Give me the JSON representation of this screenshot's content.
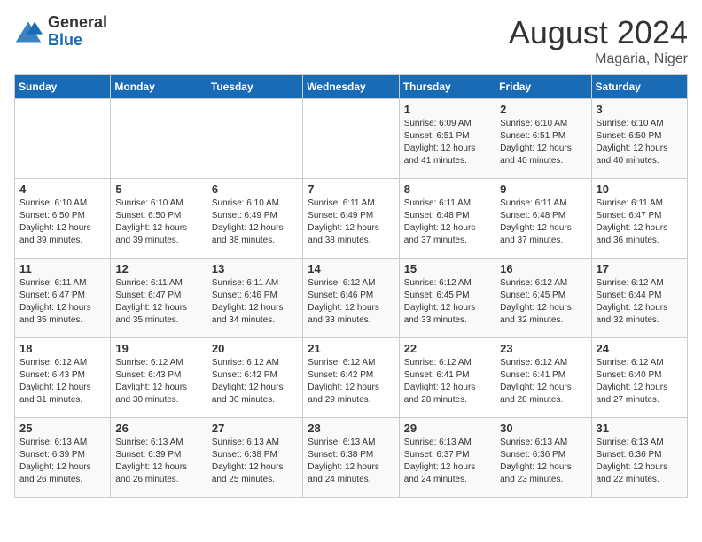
{
  "header": {
    "logo_general": "General",
    "logo_blue": "Blue",
    "month_title": "August 2024",
    "location": "Magaria, Niger"
  },
  "days_of_week": [
    "Sunday",
    "Monday",
    "Tuesday",
    "Wednesday",
    "Thursday",
    "Friday",
    "Saturday"
  ],
  "weeks": [
    [
      {
        "day": "",
        "info": ""
      },
      {
        "day": "",
        "info": ""
      },
      {
        "day": "",
        "info": ""
      },
      {
        "day": "",
        "info": ""
      },
      {
        "day": "1",
        "info": "Sunrise: 6:09 AM\nSunset: 6:51 PM\nDaylight: 12 hours\nand 41 minutes."
      },
      {
        "day": "2",
        "info": "Sunrise: 6:10 AM\nSunset: 6:51 PM\nDaylight: 12 hours\nand 40 minutes."
      },
      {
        "day": "3",
        "info": "Sunrise: 6:10 AM\nSunset: 6:50 PM\nDaylight: 12 hours\nand 40 minutes."
      }
    ],
    [
      {
        "day": "4",
        "info": "Sunrise: 6:10 AM\nSunset: 6:50 PM\nDaylight: 12 hours\nand 39 minutes."
      },
      {
        "day": "5",
        "info": "Sunrise: 6:10 AM\nSunset: 6:50 PM\nDaylight: 12 hours\nand 39 minutes."
      },
      {
        "day": "6",
        "info": "Sunrise: 6:10 AM\nSunset: 6:49 PM\nDaylight: 12 hours\nand 38 minutes."
      },
      {
        "day": "7",
        "info": "Sunrise: 6:11 AM\nSunset: 6:49 PM\nDaylight: 12 hours\nand 38 minutes."
      },
      {
        "day": "8",
        "info": "Sunrise: 6:11 AM\nSunset: 6:48 PM\nDaylight: 12 hours\nand 37 minutes."
      },
      {
        "day": "9",
        "info": "Sunrise: 6:11 AM\nSunset: 6:48 PM\nDaylight: 12 hours\nand 37 minutes."
      },
      {
        "day": "10",
        "info": "Sunrise: 6:11 AM\nSunset: 6:47 PM\nDaylight: 12 hours\nand 36 minutes."
      }
    ],
    [
      {
        "day": "11",
        "info": "Sunrise: 6:11 AM\nSunset: 6:47 PM\nDaylight: 12 hours\nand 35 minutes."
      },
      {
        "day": "12",
        "info": "Sunrise: 6:11 AM\nSunset: 6:47 PM\nDaylight: 12 hours\nand 35 minutes."
      },
      {
        "day": "13",
        "info": "Sunrise: 6:11 AM\nSunset: 6:46 PM\nDaylight: 12 hours\nand 34 minutes."
      },
      {
        "day": "14",
        "info": "Sunrise: 6:12 AM\nSunset: 6:46 PM\nDaylight: 12 hours\nand 33 minutes."
      },
      {
        "day": "15",
        "info": "Sunrise: 6:12 AM\nSunset: 6:45 PM\nDaylight: 12 hours\nand 33 minutes."
      },
      {
        "day": "16",
        "info": "Sunrise: 6:12 AM\nSunset: 6:45 PM\nDaylight: 12 hours\nand 32 minutes."
      },
      {
        "day": "17",
        "info": "Sunrise: 6:12 AM\nSunset: 6:44 PM\nDaylight: 12 hours\nand 32 minutes."
      }
    ],
    [
      {
        "day": "18",
        "info": "Sunrise: 6:12 AM\nSunset: 6:43 PM\nDaylight: 12 hours\nand 31 minutes."
      },
      {
        "day": "19",
        "info": "Sunrise: 6:12 AM\nSunset: 6:43 PM\nDaylight: 12 hours\nand 30 minutes."
      },
      {
        "day": "20",
        "info": "Sunrise: 6:12 AM\nSunset: 6:42 PM\nDaylight: 12 hours\nand 30 minutes."
      },
      {
        "day": "21",
        "info": "Sunrise: 6:12 AM\nSunset: 6:42 PM\nDaylight: 12 hours\nand 29 minutes."
      },
      {
        "day": "22",
        "info": "Sunrise: 6:12 AM\nSunset: 6:41 PM\nDaylight: 12 hours\nand 28 minutes."
      },
      {
        "day": "23",
        "info": "Sunrise: 6:12 AM\nSunset: 6:41 PM\nDaylight: 12 hours\nand 28 minutes."
      },
      {
        "day": "24",
        "info": "Sunrise: 6:12 AM\nSunset: 6:40 PM\nDaylight: 12 hours\nand 27 minutes."
      }
    ],
    [
      {
        "day": "25",
        "info": "Sunrise: 6:13 AM\nSunset: 6:39 PM\nDaylight: 12 hours\nand 26 minutes."
      },
      {
        "day": "26",
        "info": "Sunrise: 6:13 AM\nSunset: 6:39 PM\nDaylight: 12 hours\nand 26 minutes."
      },
      {
        "day": "27",
        "info": "Sunrise: 6:13 AM\nSunset: 6:38 PM\nDaylight: 12 hours\nand 25 minutes."
      },
      {
        "day": "28",
        "info": "Sunrise: 6:13 AM\nSunset: 6:38 PM\nDaylight: 12 hours\nand 24 minutes."
      },
      {
        "day": "29",
        "info": "Sunrise: 6:13 AM\nSunset: 6:37 PM\nDaylight: 12 hours\nand 24 minutes."
      },
      {
        "day": "30",
        "info": "Sunrise: 6:13 AM\nSunset: 6:36 PM\nDaylight: 12 hours\nand 23 minutes."
      },
      {
        "day": "31",
        "info": "Sunrise: 6:13 AM\nSunset: 6:36 PM\nDaylight: 12 hours\nand 22 minutes."
      }
    ]
  ]
}
